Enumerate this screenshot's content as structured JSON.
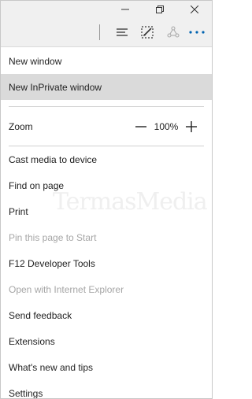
{
  "window_controls": {
    "minimize": "minimize-icon",
    "restore": "restore-icon",
    "close": "close-icon"
  },
  "toolbar": {
    "buttons": [
      "hub-icon",
      "web-note-icon",
      "share-icon",
      "more-icon"
    ],
    "accent": "#0063b1"
  },
  "menu": {
    "items_top": [
      {
        "label": "New window",
        "state": "normal"
      },
      {
        "label": "New InPrivate window",
        "state": "hover"
      }
    ],
    "zoom": {
      "label": "Zoom",
      "value": "100%"
    },
    "items_bottom": [
      {
        "label": "Cast media to device",
        "state": "normal"
      },
      {
        "label": "Find on page",
        "state": "normal"
      },
      {
        "label": "Print",
        "state": "normal"
      },
      {
        "label": "Pin this page to Start",
        "state": "disabled"
      },
      {
        "label": "F12 Developer Tools",
        "state": "normal"
      },
      {
        "label": "Open with Internet Explorer",
        "state": "disabled"
      },
      {
        "label": "Send feedback",
        "state": "normal"
      },
      {
        "label": "Extensions",
        "state": "normal"
      },
      {
        "label": "What's new and tips",
        "state": "normal"
      },
      {
        "label": "Settings",
        "state": "normal"
      }
    ]
  },
  "watermark": "TermasMedia",
  "colors": {
    "hover_bg": "#dadada",
    "disabled_text": "#a6a6a6",
    "toolbar_bg": "#f0f0f0"
  }
}
